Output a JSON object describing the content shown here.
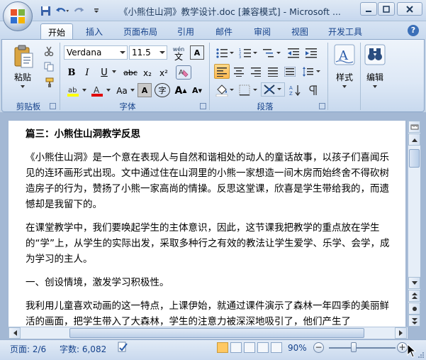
{
  "window": {
    "title": "《小熊住山洞》教学设计.doc [兼容模式] - Microsoft ..."
  },
  "tabs": [
    "开始",
    "插入",
    "页面布局",
    "引用",
    "邮件",
    "审阅",
    "视图",
    "开发工具"
  ],
  "font": {
    "name": "Verdana",
    "size": "11.5"
  },
  "groups": {
    "clipboard": "剪贴板",
    "font": "字体",
    "paragraph": "段落"
  },
  "clipboard": {
    "paste_label": "粘贴"
  },
  "styles": {
    "label": "样式"
  },
  "editing": {
    "label": "编辑"
  },
  "font_buttons": {
    "bold": "B",
    "italic": "I",
    "underline": "U",
    "strike": "abc",
    "subscript": "x₂",
    "superscript": "x²",
    "char_border": "A",
    "char_shade": "A",
    "enclose": "字",
    "grow": "A",
    "shrink": "A",
    "case": "Aa",
    "phonetic": "wén",
    "phonetic_char": "文"
  },
  "document": {
    "heading": "篇三：小熊住山洞教学反思",
    "paragraphs": [
      "《小熊住山洞》是一个意在表现人与自然和谐相处的动人的童话故事，以孩子们喜闻乐见的连环画形式出现。文中通过住在山洞里的小熊一家想造一间木房而始终舍不得砍树造房子的行为，赞扬了小熊一家高尚的情操。反思这堂课，欣喜是学生带给我的，而遗憾却是我留下的。",
      "在课堂教学中，我们要唤起学生的主体意识，因此，这节课我把教学的重点放在学生的“学”上，从学生的实际出发，采取多种行之有效的教法让学生爱学、乐学、会学，成为学习的主人。",
      "一、创设情境，激发学习积极性。",
      "我利用儿童喜欢动画的这一特点，上课伊始，就通过课件演示了森林一年四季的美丽鲜活的画面，把学生带入了大森林，学生的注意力被深深地吸引了，他们产生了"
    ]
  },
  "status": {
    "page": "页面: 2/6",
    "words": "字数: 6,082",
    "zoom": "90%"
  }
}
